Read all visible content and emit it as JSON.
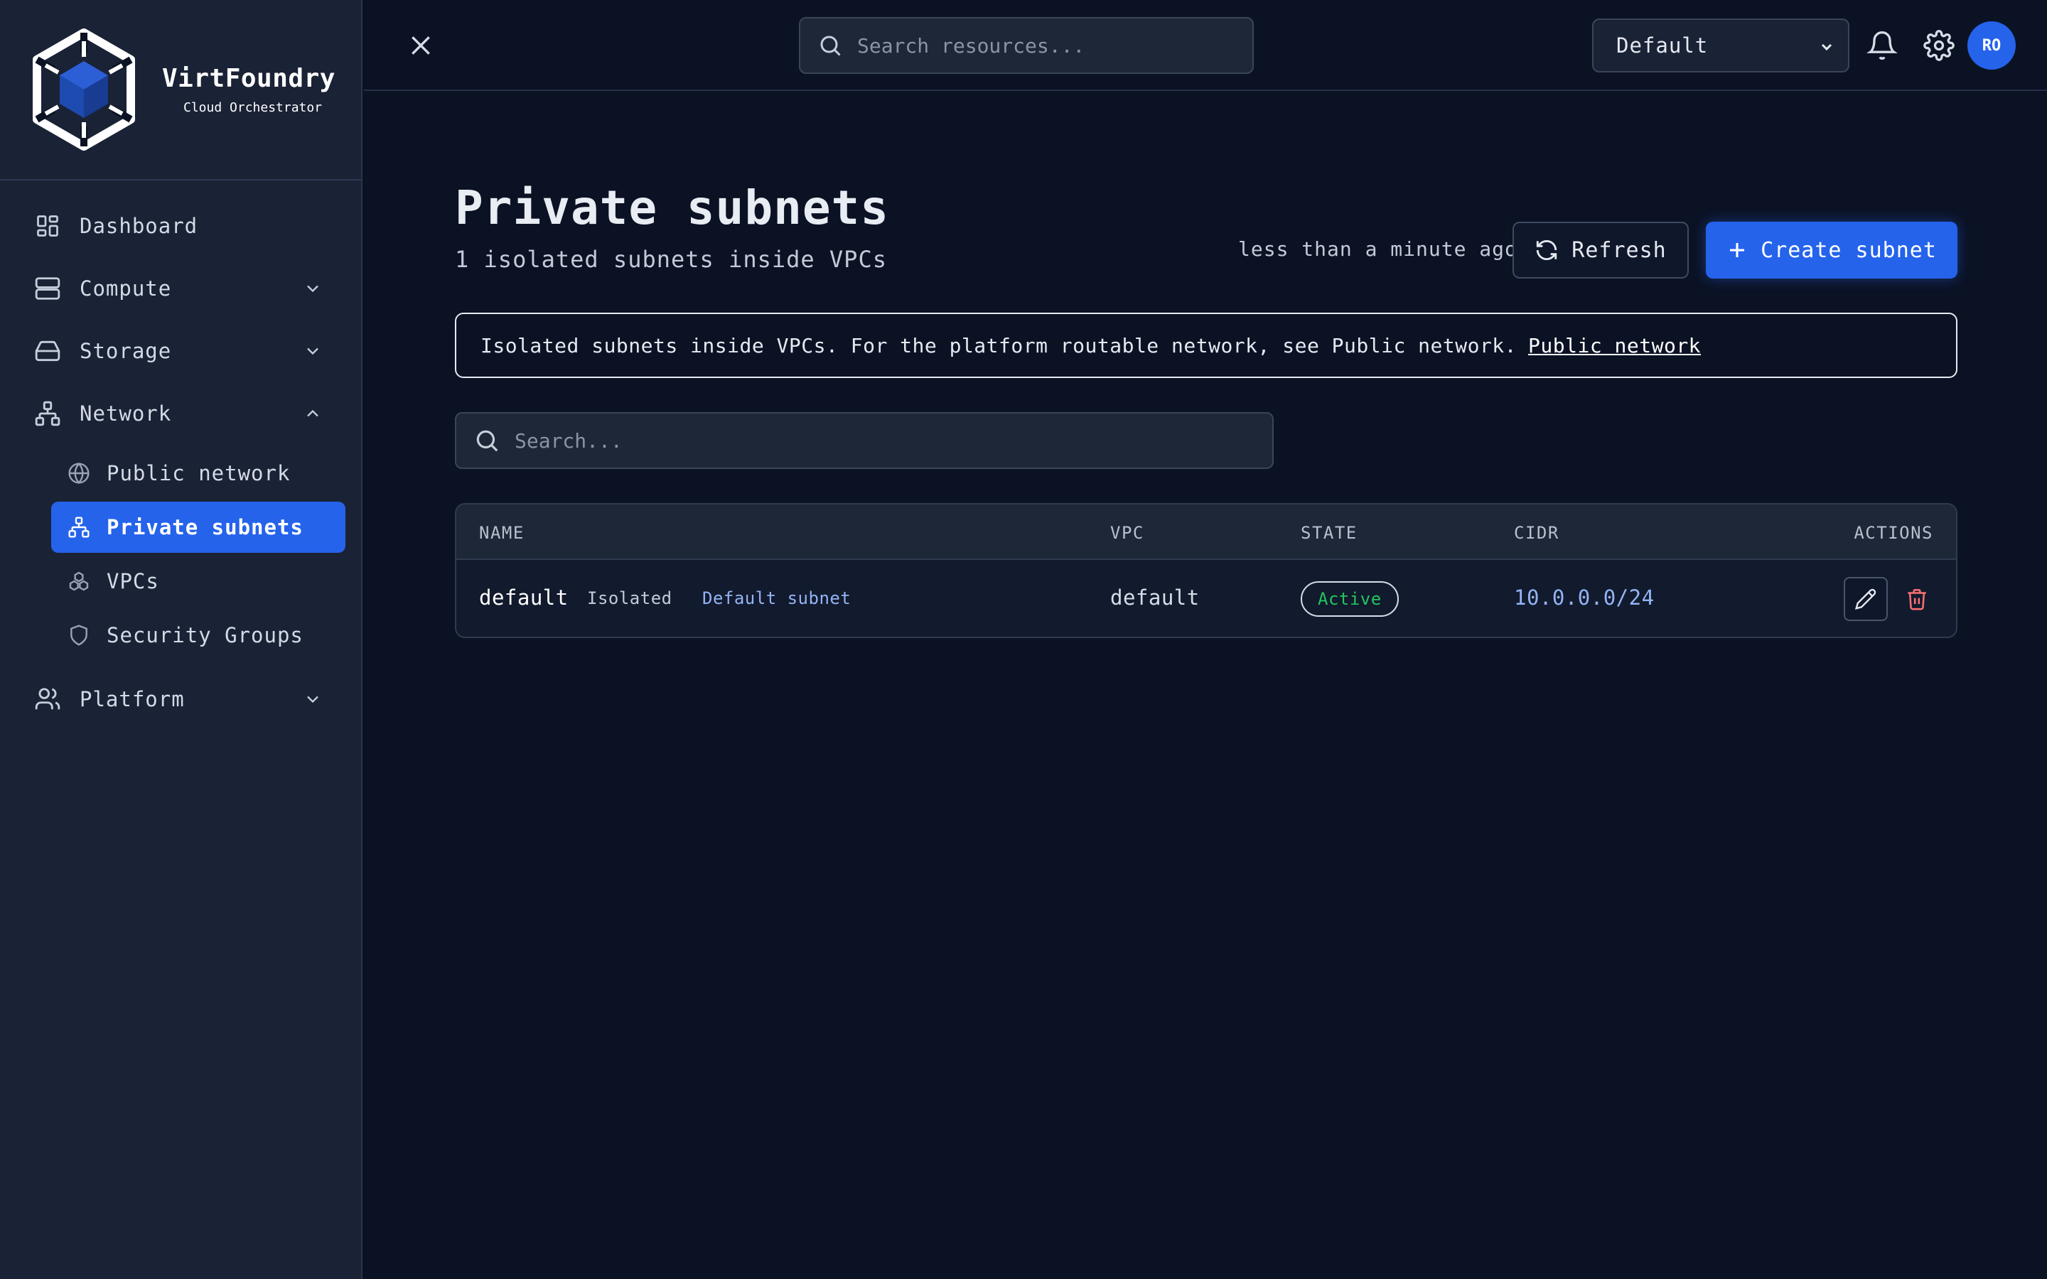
{
  "brand": {
    "name": "VirtFoundry",
    "tagline": "Cloud Orchestrator"
  },
  "sidebar": {
    "items": [
      {
        "label": "Dashboard",
        "icon": "dashboard-icon"
      },
      {
        "label": "Compute",
        "icon": "server-icon",
        "expandable": true,
        "expanded": false
      },
      {
        "label": "Storage",
        "icon": "hard-drive-icon",
        "expandable": true,
        "expanded": false
      },
      {
        "label": "Network",
        "icon": "network-icon",
        "expandable": true,
        "expanded": true,
        "children": [
          {
            "label": "Public network",
            "icon": "globe-icon"
          },
          {
            "label": "Private subnets",
            "icon": "network-icon",
            "active": true
          },
          {
            "label": "VPCs",
            "icon": "boxes-icon"
          },
          {
            "label": "Security Groups",
            "icon": "shield-icon"
          }
        ]
      },
      {
        "label": "Platform",
        "icon": "users-icon",
        "expandable": true,
        "expanded": false
      }
    ]
  },
  "topbar": {
    "search_placeholder": "Search resources...",
    "project": "Default",
    "avatar_initials": "RO"
  },
  "page": {
    "title": "Private subnets",
    "subtitle": "1 isolated subnets inside VPCs",
    "updated": "less than a minute ago",
    "refresh_label": "Refresh",
    "create_label": "Create subnet",
    "info_text": "Isolated subnets inside VPCs. For the platform routable network, see Public network.",
    "info_link": "Public network",
    "search_placeholder": "Search..."
  },
  "table": {
    "columns": [
      "NAME",
      "VPC",
      "STATE",
      "CIDR",
      "ACTIONS"
    ],
    "rows": [
      {
        "name": "default",
        "tags": [
          "Isolated",
          "Default subnet"
        ],
        "vpc": "default",
        "state": "Active",
        "cidr": "10.0.0.0/24"
      }
    ]
  },
  "colors": {
    "accent": "#2563eb",
    "background": "#0b1224",
    "sidebar": "#1a2236",
    "state_active": "#22c55e",
    "danger": "#f87171",
    "link_blue": "#93b4f5"
  }
}
